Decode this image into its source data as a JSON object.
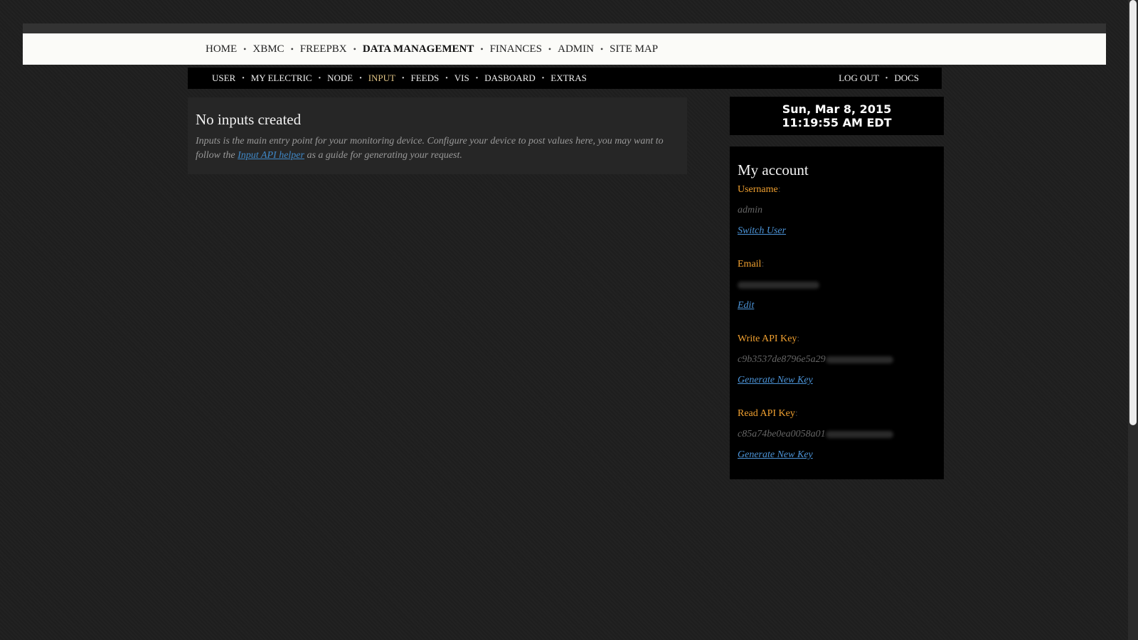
{
  "top_nav": {
    "items": [
      "HOME",
      "XBMC",
      "FREEPBX",
      "DATA MANAGEMENT",
      "FINANCES",
      "ADMIN",
      "SITE MAP"
    ],
    "active": "DATA MANAGEMENT"
  },
  "sub_nav": {
    "items": [
      "USER",
      "MY ELECTRIC",
      "NODE",
      "INPUT",
      "FEEDS",
      "VIS",
      "DASBOARD",
      "EXTRAS"
    ],
    "active": "INPUT",
    "right_items": [
      "LOG OUT",
      "DOCS"
    ],
    "active_color": "#e0c485"
  },
  "main": {
    "title": "No inputs created",
    "desc_before": "Inputs is the main entry point for your monitoring device. Configure your device to post values here, you may want to follow the ",
    "desc_link": "Input API helper",
    "desc_after": " as a guide for generating your request."
  },
  "clock": {
    "date": "Sun, Mar 8, 2015",
    "time": "11:19:55 AM EDT"
  },
  "account": {
    "title": "My account",
    "username_label": "Username",
    "username_value": "admin",
    "switch_user": "Switch User",
    "email_label": "Email",
    "edit": "Edit",
    "write_key_label": "Write API Key",
    "write_key_value": "c9b3537de8796e5a29",
    "generate_write": "Generate New Key",
    "read_key_label": "Read API Key",
    "read_key_value": "c85a74be0ea0058a01",
    "generate_read": "Generate New Key",
    "label_color": "#f0a030",
    "link_color": "#4c94d8"
  }
}
